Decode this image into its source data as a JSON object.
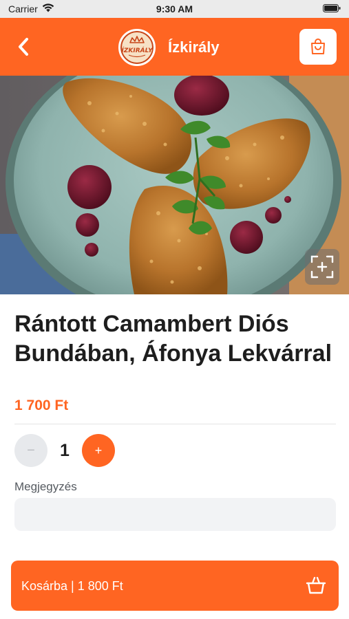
{
  "status_bar": {
    "carrier": "Carrier",
    "time": "9:30 AM",
    "icons": [
      "wifi-icon",
      "battery-icon"
    ]
  },
  "header": {
    "title": "Ízkirály",
    "logo_text": "ÍZKIRÁLY",
    "icons": [
      "chevron-left-icon",
      "shopping-bag-icon"
    ]
  },
  "product": {
    "name": "Rántott Camambert Diós Bundában, Áfonya Lekvárral",
    "price": "1 700 Ft",
    "image_icons": [
      "expand-icon"
    ]
  },
  "quantity": {
    "minus_label": "−",
    "value": "1",
    "plus_label": "+"
  },
  "note": {
    "label": "Megjegyzés",
    "value": "",
    "placeholder": ""
  },
  "cta": {
    "label": "Kosárba | 1 800 Ft",
    "icon": "basket-icon"
  },
  "colors": {
    "accent": "#ff6522",
    "status_bar": "#ebebeb",
    "text": "#1e1e1e",
    "input_bg": "#f2f3f5",
    "stepper_disabled": "#e7e9ec"
  }
}
